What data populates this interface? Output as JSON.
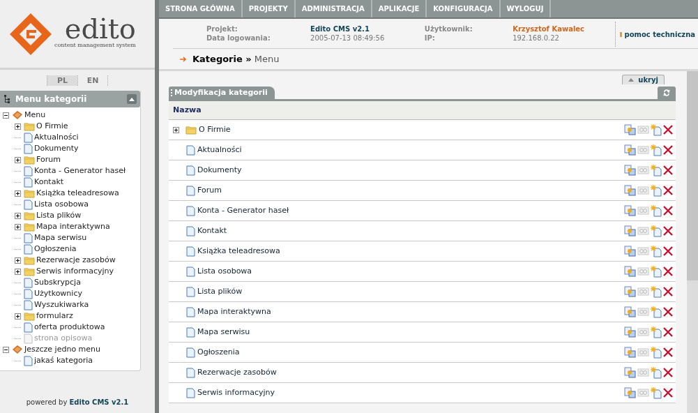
{
  "logo": {
    "name": "edito",
    "tagline": "content management system"
  },
  "languages": [
    {
      "label": "PL",
      "selected": true
    },
    {
      "label": "EN",
      "selected": false
    }
  ],
  "sidebar": {
    "title": "Menu kategorii",
    "tree": [
      {
        "label": "Menu",
        "kind": "menu",
        "expanded": true,
        "children": [
          {
            "label": "O Firmie",
            "kind": "folder",
            "expanded": false
          },
          {
            "label": "Aktualności",
            "kind": "page",
            "disabled": false
          },
          {
            "label": "Dokumenty",
            "kind": "page",
            "disabled": false
          },
          {
            "label": "Forum",
            "kind": "folder",
            "expanded": false
          },
          {
            "label": "Konta - Generator haseł",
            "kind": "page",
            "disabled": false
          },
          {
            "label": "Kontakt",
            "kind": "page",
            "disabled": false
          },
          {
            "label": "Książka teleadresowa",
            "kind": "folder",
            "expanded": false
          },
          {
            "label": "Lista osobowa",
            "kind": "page",
            "disabled": false
          },
          {
            "label": "Lista plików",
            "kind": "folder",
            "expanded": false
          },
          {
            "label": "Mapa interaktywna",
            "kind": "folder",
            "expanded": false
          },
          {
            "label": "Mapa serwisu",
            "kind": "page",
            "disabled": false
          },
          {
            "label": "Ogłoszenia",
            "kind": "page",
            "disabled": false
          },
          {
            "label": "Rezerwacje zasobów",
            "kind": "folder",
            "expanded": false
          },
          {
            "label": "Serwis informacyjny",
            "kind": "folder",
            "expanded": false
          },
          {
            "label": "Subskrypcja",
            "kind": "page",
            "disabled": false
          },
          {
            "label": "Użytkownicy",
            "kind": "page",
            "disabled": false
          },
          {
            "label": "Wyszukiwarka",
            "kind": "page",
            "disabled": false
          },
          {
            "label": "formularz",
            "kind": "folder",
            "expanded": false
          },
          {
            "label": "oferta produktowa",
            "kind": "page",
            "disabled": false
          },
          {
            "label": "strona opisowa",
            "kind": "page",
            "disabled": true
          }
        ]
      },
      {
        "label": "Jeszcze jedno menu",
        "kind": "menu",
        "expanded": true,
        "children": [
          {
            "label": "jakaś kategoria",
            "kind": "page",
            "disabled": false
          }
        ]
      }
    ]
  },
  "powered_by": {
    "prefix": "powered by",
    "product": "Edito CMS v2.1"
  },
  "nav": [
    "STRONA GŁÓWNA",
    "PROJEKTY",
    "ADMINISTRACJA",
    "APLIKACJE",
    "KONFIGURACJA",
    "WYLOGUJ"
  ],
  "info": {
    "project_label": "Projekt:",
    "project": "Edito CMS v2.1",
    "login_label": "Data logowania:",
    "login": "2005-07-13 08:49:56",
    "user_label": "Użytkownik:",
    "user": "Krzysztof Kawalec",
    "ip_label": "IP:",
    "ip": "192.168.0.22",
    "help": "pomoc techniczna"
  },
  "breadcrumb": {
    "current": "Kategorie",
    "separator": "»",
    "child": "Menu"
  },
  "hide_button": "ukryj",
  "panel": {
    "title": "Modyfikacja kategorii",
    "column": "Nazwa",
    "rows": [
      {
        "name": "O Firmie",
        "kind": "folder"
      },
      {
        "name": "Aktualności",
        "kind": "page"
      },
      {
        "name": "Dokumenty",
        "kind": "page"
      },
      {
        "name": "Forum",
        "kind": "page"
      },
      {
        "name": "Konta - Generator haseł",
        "kind": "page"
      },
      {
        "name": "Kontakt",
        "kind": "page"
      },
      {
        "name": "Książka teleadresowa",
        "kind": "page"
      },
      {
        "name": "Lista osobowa",
        "kind": "page"
      },
      {
        "name": "Lista plików",
        "kind": "page"
      },
      {
        "name": "Mapa interaktywna",
        "kind": "page"
      },
      {
        "name": "Mapa serwisu",
        "kind": "page"
      },
      {
        "name": "Ogłoszenia",
        "kind": "page"
      },
      {
        "name": "Rezerwacje zasobów",
        "kind": "page"
      },
      {
        "name": "Serwis informacyjny",
        "kind": "page"
      }
    ]
  }
}
